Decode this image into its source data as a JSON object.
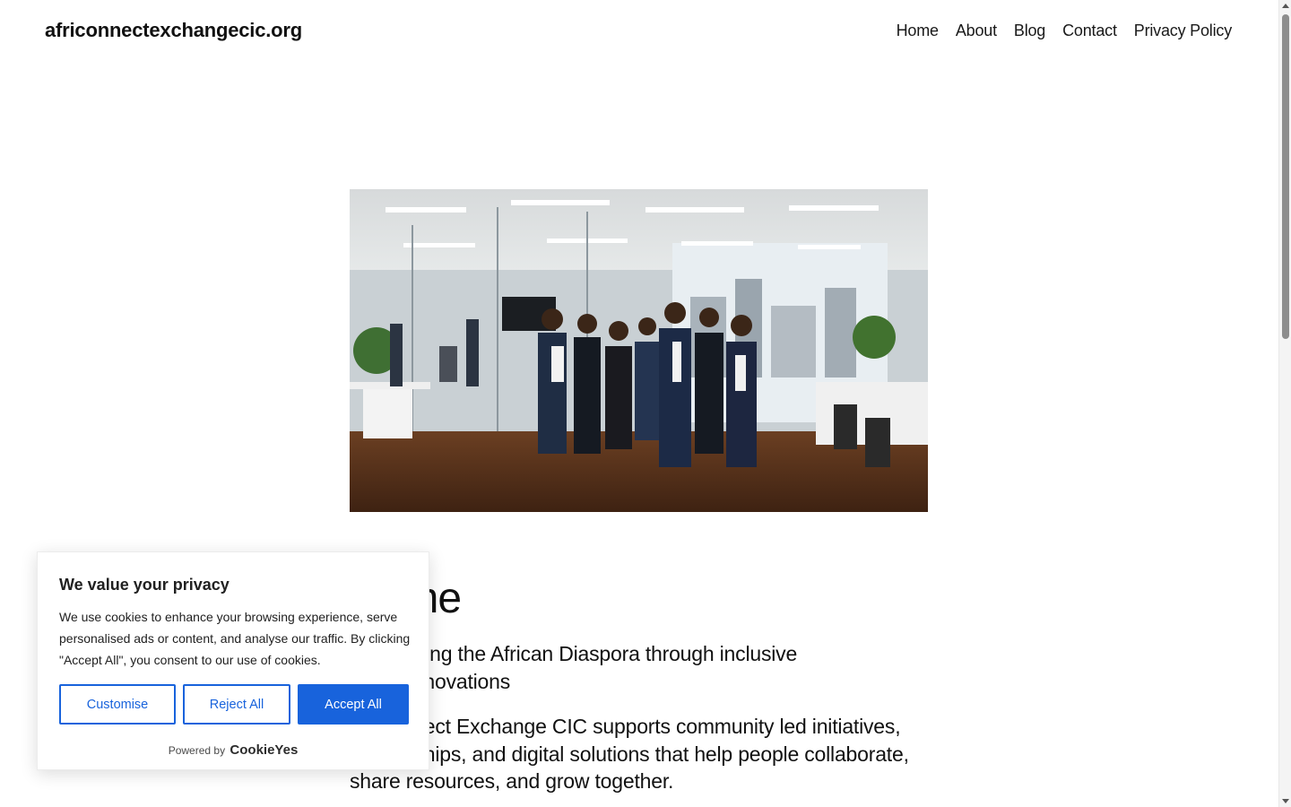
{
  "header": {
    "site_title": "africonnectexchangecic.org",
    "nav": [
      "Home",
      "About",
      "Blog",
      "Contact",
      "Privacy Policy"
    ]
  },
  "hero": {
    "image_icon": "office-team-photo"
  },
  "main": {
    "heading": "Home",
    "subtitle": "Connecting the African Diaspora through inclusive digital innovations",
    "body": "Africonnect Exchange CIC supports community led initiatives, partnerships, and digital solutions that help people collaborate, share resources, and grow together."
  },
  "cookie_banner": {
    "title": "We value your privacy",
    "text": "We use cookies to enhance your browsing experience, serve personalised ads or content, and analyse our traffic. By clicking \"Accept All\", you consent to our use of cookies.",
    "customise_label": "Customise",
    "reject_label": "Reject All",
    "accept_label": "Accept All",
    "powered_by": "Powered by",
    "brand": "CookieYes",
    "accent_color": "#1863dc"
  }
}
